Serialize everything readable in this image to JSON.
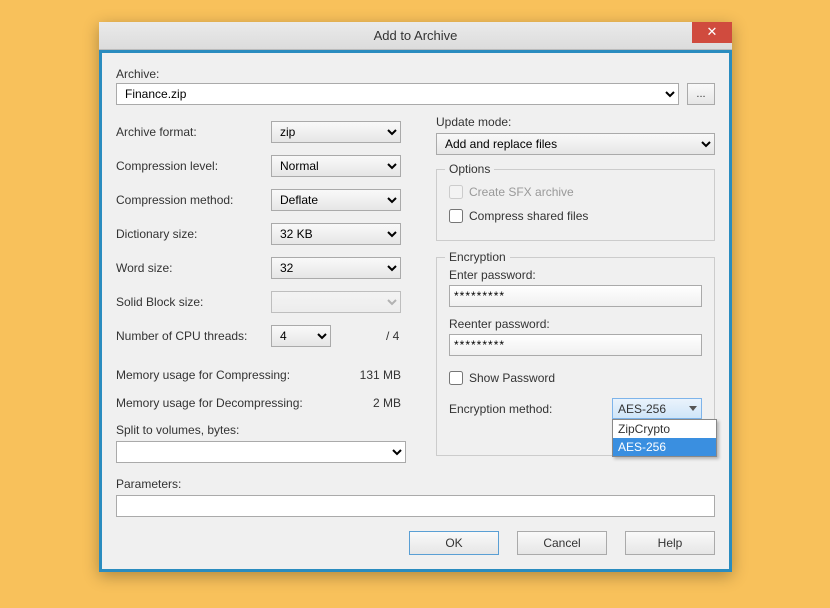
{
  "window": {
    "title": "Add to Archive",
    "close_glyph": "✕"
  },
  "archive": {
    "label": "Archive:",
    "value": "Finance.zip",
    "browse": "..."
  },
  "left": {
    "format_label": "Archive format:",
    "format_value": "zip",
    "level_label": "Compression level:",
    "level_value": "Normal",
    "method_label": "Compression method:",
    "method_value": "Deflate",
    "dict_label": "Dictionary size:",
    "dict_value": "32 KB",
    "word_label": "Word size:",
    "word_value": "32",
    "solid_label": "Solid Block size:",
    "solid_value": "",
    "threads_label": "Number of CPU threads:",
    "threads_value": "4",
    "threads_total": "/ 4",
    "mem_compress_label": "Memory usage for Compressing:",
    "mem_compress_value": "131 MB",
    "mem_decompress_label": "Memory usage for Decompressing:",
    "mem_decompress_value": "2 MB",
    "split_label": "Split to volumes, bytes:",
    "split_value": ""
  },
  "right": {
    "update_label": "Update mode:",
    "update_value": "Add and replace files",
    "options_legend": "Options",
    "opt_sfx": "Create SFX archive",
    "opt_shared": "Compress shared files",
    "enc_legend": "Encryption",
    "enter_pwd_label": "Enter password:",
    "enter_pwd_value": "*********",
    "reenter_pwd_label": "Reenter password:",
    "reenter_pwd_value": "*********",
    "show_pwd": "Show Password",
    "enc_method_label": "Encryption method:",
    "enc_method_value": "AES-256",
    "enc_options": [
      "ZipCrypto",
      "AES-256"
    ]
  },
  "params": {
    "label": "Parameters:",
    "value": ""
  },
  "buttons": {
    "ok": "OK",
    "cancel": "Cancel",
    "help": "Help"
  }
}
